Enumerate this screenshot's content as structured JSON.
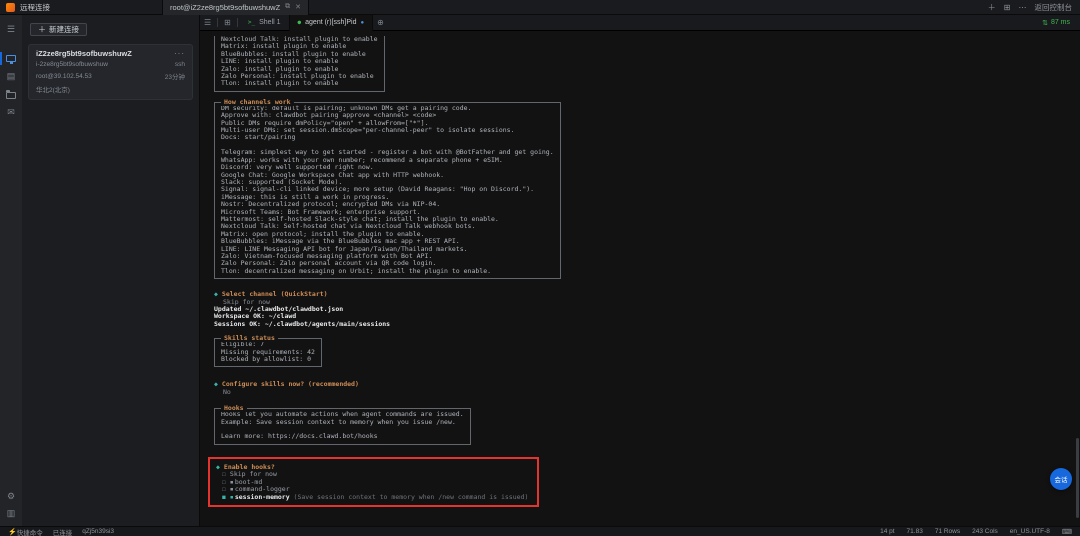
{
  "app": {
    "title": "远程连接",
    "back_label": "返回控制台"
  },
  "titlebar": {
    "session_tab": "root@iZ2ze8rg5bt9sofbuwshuwZ"
  },
  "panel": {
    "new_connection": "新建连接",
    "card": {
      "name": "iZ2ze8rg5bt9sofbuwshuwZ",
      "instance_id": "i-2ze8rg5bt9sofbuwshuw",
      "protocol": "ssh",
      "user_host": "root@39.102.54.53",
      "duration": "23分钟",
      "region": "华北2(北京)",
      "more": "···"
    }
  },
  "tabbar": {
    "tabs": [
      {
        "label": "Shell 1"
      },
      {
        "label": "agent (r)[ssh]Pid"
      }
    ],
    "latency": "87 ms"
  },
  "terminal": {
    "marker": "◆",
    "plugin_box": {
      "lines": [
        "Nextcloud Talk: install plugin to enable",
        "Matrix: install plugin to enable",
        "BlueBubbles: install plugin to enable",
        "LINE: install plugin to enable",
        "Zalo: install plugin to enable",
        "Zalo Personal: install plugin to enable",
        "Tlon: install plugin to enable"
      ]
    },
    "channels_box": {
      "title": "How channels work",
      "lines": [
        "DM security: default is pairing; unknown DMs get a pairing code.",
        "Approve with: clawdbot pairing approve <channel> <code>",
        "Public DMs require dmPolicy=\"open\" + allowFrom=[\"*\"].",
        "Multi-user DMs: set session.dmScope=\"per-channel-peer\" to isolate sessions.",
        "Docs: start/pairing",
        "",
        "Telegram: simplest way to get started - register a bot with @BotFather and get going.",
        "WhatsApp: works with your own number; recommend a separate phone + eSIM.",
        "Discord: very well supported right now.",
        "Google Chat: Google Workspace Chat app with HTTP webhook.",
        "Slack: supported (Socket Mode).",
        "Signal: signal-cli linked device; more setup (David Reagans: \"Hop on Discord.\").",
        "iMessage: this is still a work in progress.",
        "Nostr: Decentralized protocol; encrypted DMs via NIP-04.",
        "Microsoft Teams: Bot Framework; enterprise support.",
        "Mattermost: self-hosted Slack-style chat; install the plugin to enable.",
        "Nextcloud Talk: Self-hosted chat via Nextcloud Talk webhook bots.",
        "Matrix: open protocol; install the plugin to enable.",
        "BlueBubbles: iMessage via the BlueBubbles mac app + REST API.",
        "LINE: LINE Messaging API bot for Japan/Taiwan/Thailand markets.",
        "Zalo: Vietnam-focused messaging platform with Bot API.",
        "Zalo Personal: Zalo personal account via QR code login.",
        "Tlon: decentralized messaging on Urbit; install the plugin to enable."
      ]
    },
    "select_channel": {
      "prompt": "Select channel (QuickStart)",
      "answer": "Skip for now"
    },
    "result_lines": [
      "Updated ~/.clawdbot/clawdbot.json",
      "Workspace OK: ~/clawd",
      "Sessions OK: ~/.clawdbot/agents/main/sessions"
    ],
    "skills_box": {
      "title": "Skills status",
      "lines": [
        "Eligible: 7",
        "Missing requirements: 42",
        "Blocked by allowlist: 0"
      ]
    },
    "configure_skills": {
      "prompt": "Configure skills now? (recommended)",
      "answer": "No"
    },
    "hooks_box": {
      "title": "Hooks",
      "lines": [
        "Hooks let you automate actions when agent commands are issued.",
        "Example: Save session context to memory when you issue /new.",
        "",
        "Learn more: https://docs.clawd.bot/hooks"
      ]
    },
    "enable_hooks": {
      "prompt": "Enable hooks?",
      "options": [
        {
          "checked": false,
          "icon": false,
          "label": "Skip for now",
          "desc": ""
        },
        {
          "checked": false,
          "icon": true,
          "label": "boot-md",
          "desc": ""
        },
        {
          "checked": false,
          "icon": true,
          "label": "command-logger",
          "desc": ""
        },
        {
          "checked": true,
          "icon": true,
          "label": "session-memory",
          "desc": "(Save session context to memory when /new command is issued)"
        }
      ]
    }
  },
  "fab": {
    "label": "会话"
  },
  "statusbar": {
    "left": [
      "快捷命令",
      "已连接",
      "qZj5n39si3"
    ],
    "right": [
      "14 pt",
      "71.83",
      "71 Rows",
      "243 Cols",
      "en_US.UTF-8"
    ]
  },
  "colors": {
    "accent": "#1668dc",
    "green": "#3fb950",
    "orange": "#cf8e57",
    "teal": "#35b5a8",
    "annotation_red": "#e5342e"
  }
}
